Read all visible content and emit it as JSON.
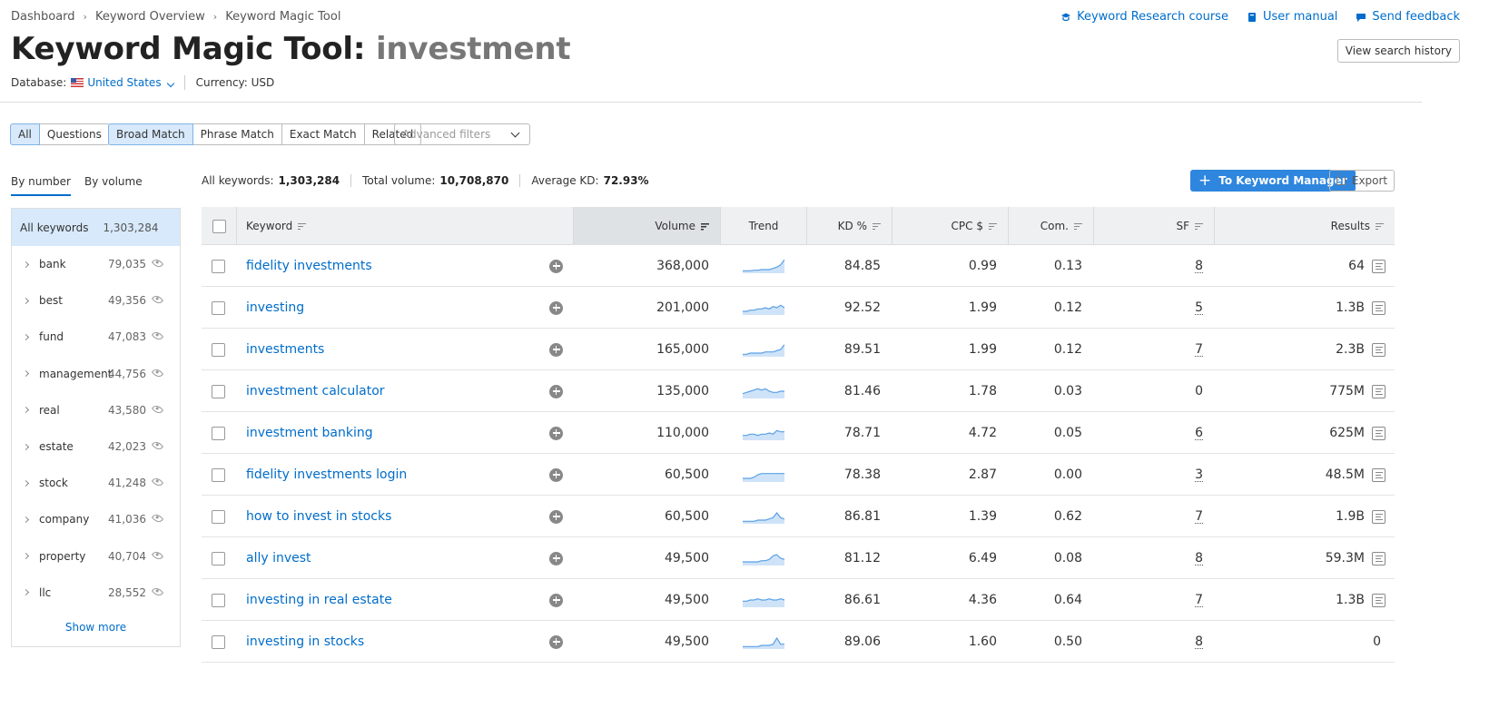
{
  "breadcrumb": [
    "Dashboard",
    "Keyword Overview",
    "Keyword Magic Tool"
  ],
  "top_links": {
    "course": "Keyword Research course",
    "manual": "User manual",
    "feedback": "Send feedback"
  },
  "title": {
    "prefix": "Keyword Magic Tool:",
    "query": "investment"
  },
  "history_button": "View search history",
  "meta": {
    "database_label": "Database:",
    "database_value": "United States",
    "currency": "Currency: USD"
  },
  "filters": {
    "type_tabs": [
      "All",
      "Questions"
    ],
    "match_tabs": [
      "Broad Match",
      "Phrase Match",
      "Exact Match",
      "Related"
    ],
    "advanced_placeholder": "Advanced filters"
  },
  "side_tabs": [
    "By number",
    "By volume"
  ],
  "summary": {
    "all_label": "All keywords:",
    "all_value": "1,303,284",
    "volume_label": "Total volume:",
    "volume_value": "10,708,870",
    "kd_label": "Average KD:",
    "kd_value": "72.93%"
  },
  "buttons": {
    "keyword_manager": "To Keyword Manager",
    "export": "Export"
  },
  "sidebar": {
    "all_label": "All keywords",
    "all_count": "1,303,284",
    "groups": [
      {
        "label": "bank",
        "count": "79,035"
      },
      {
        "label": "best",
        "count": "49,356"
      },
      {
        "label": "fund",
        "count": "47,083"
      },
      {
        "label": "management",
        "count": "44,756"
      },
      {
        "label": "real",
        "count": "43,580"
      },
      {
        "label": "estate",
        "count": "42,023"
      },
      {
        "label": "stock",
        "count": "41,248"
      },
      {
        "label": "company",
        "count": "41,036"
      },
      {
        "label": "property",
        "count": "40,704"
      },
      {
        "label": "llc",
        "count": "28,552"
      }
    ],
    "show_more": "Show more"
  },
  "table": {
    "headers": {
      "keyword": "Keyword",
      "volume": "Volume",
      "trend": "Trend",
      "kd": "KD %",
      "cpc": "CPC $",
      "com": "Com.",
      "sf": "SF",
      "results": "Results"
    },
    "rows": [
      {
        "keyword": "fidelity investments",
        "volume": "368,000",
        "kd": "84.85",
        "cpc": "0.99",
        "com": "0.13",
        "sf": "8",
        "results": "64",
        "trend": [
          2,
          2,
          2,
          2.5,
          2.5,
          3,
          3,
          3,
          4,
          5,
          7,
          11
        ]
      },
      {
        "keyword": "investing",
        "volume": "201,000",
        "kd": "92.52",
        "cpc": "1.99",
        "com": "0.12",
        "sf": "5",
        "results": "1.3B",
        "trend": [
          3,
          3,
          4,
          4,
          5,
          5,
          6,
          5,
          7,
          6,
          8,
          6
        ]
      },
      {
        "keyword": "investments",
        "volume": "165,000",
        "kd": "89.51",
        "cpc": "1.99",
        "com": "0.12",
        "sf": "7",
        "results": "2.3B",
        "trend": [
          2,
          2,
          3,
          3,
          3,
          3,
          4,
          4,
          4,
          5,
          6,
          10
        ]
      },
      {
        "keyword": "investment calculator",
        "volume": "135,000",
        "kd": "81.46",
        "cpc": "1.78",
        "com": "0.03",
        "sf": "0",
        "results": "775M",
        "trend": [
          4,
          5,
          6,
          7,
          8,
          7,
          8,
          6,
          5,
          5,
          6,
          6
        ]
      },
      {
        "keyword": "investment banking",
        "volume": "110,000",
        "kd": "78.71",
        "cpc": "4.72",
        "com": "0.05",
        "sf": "6",
        "results": "625M",
        "trend": [
          4,
          4,
          5,
          5,
          4,
          5,
          5,
          6,
          5,
          8,
          7,
          7
        ]
      },
      {
        "keyword": "fidelity investments login",
        "volume": "60,500",
        "kd": "78.38",
        "cpc": "2.87",
        "com": "0.00",
        "sf": "3",
        "results": "48.5M",
        "trend": [
          3,
          3,
          3,
          4,
          6,
          7,
          7,
          7,
          7,
          7,
          7,
          7
        ]
      },
      {
        "keyword": "how to invest in stocks",
        "volume": "60,500",
        "kd": "86.81",
        "cpc": "1.39",
        "com": "0.62",
        "sf": "7",
        "results": "1.9B",
        "trend": [
          2,
          2,
          2,
          2,
          3,
          3,
          3,
          4,
          5,
          9,
          5,
          4
        ]
      },
      {
        "keyword": "ally invest",
        "volume": "49,500",
        "kd": "81.12",
        "cpc": "6.49",
        "com": "0.08",
        "sf": "8",
        "results": "59.3M",
        "trend": [
          3,
          3,
          3,
          3,
          3,
          4,
          4,
          5,
          8,
          9,
          6,
          5
        ]
      },
      {
        "keyword": "investing in real estate",
        "volume": "49,500",
        "kd": "86.61",
        "cpc": "4.36",
        "com": "0.64",
        "sf": "7",
        "results": "1.3B",
        "trend": [
          5,
          5,
          6,
          6,
          7,
          6,
          6,
          7,
          6,
          6,
          7,
          6
        ]
      },
      {
        "keyword": "investing in stocks",
        "volume": "49,500",
        "kd": "89.06",
        "cpc": "1.60",
        "com": "0.50",
        "sf": "8",
        "results": "0",
        "trend": [
          2,
          2,
          2,
          2,
          2,
          3,
          3,
          3,
          4,
          9,
          4,
          4
        ]
      }
    ]
  },
  "colors": {
    "accent": "#2e86de",
    "link": "#006dca",
    "trend_fill": "#cfe3f8",
    "trend_line": "#5aa0e6"
  }
}
